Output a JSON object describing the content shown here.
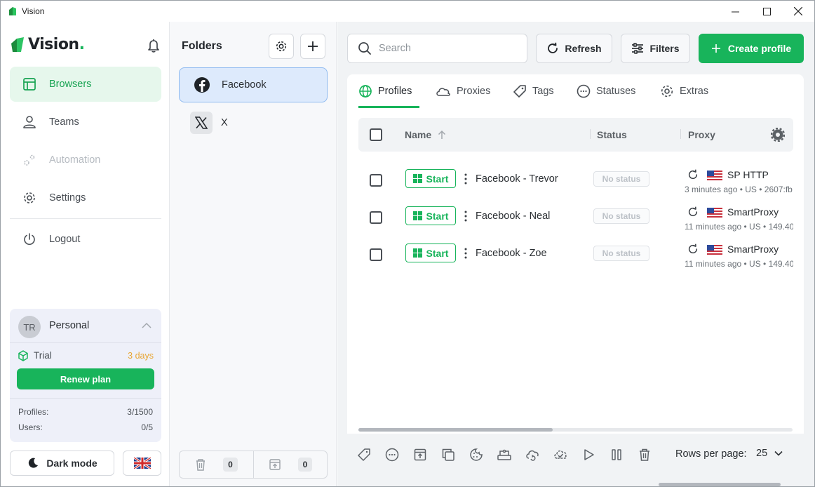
{
  "window": {
    "title": "Vision"
  },
  "sidebar": {
    "logo_text": "Vision",
    "logo_dot": ".",
    "nav": [
      {
        "label": "Browsers",
        "icon": "browser-window-icon",
        "state": "active"
      },
      {
        "label": "Teams",
        "icon": "user-icon",
        "state": "normal"
      },
      {
        "label": "Automation",
        "icon": "gears-icon",
        "state": "disabled"
      },
      {
        "label": "Settings",
        "icon": "gear-icon",
        "state": "normal"
      },
      {
        "label": "Logout",
        "icon": "power-icon",
        "state": "normal"
      }
    ],
    "account": {
      "initials": "TR",
      "name": "Personal",
      "plan_label": "Trial",
      "plan_remaining": "3 days",
      "renew_label": "Renew plan",
      "profiles_label": "Profiles:",
      "profiles_value": "3/1500",
      "users_label": "Users:",
      "users_value": "0/5"
    },
    "dark_mode_label": "Dark mode",
    "language": "en-GB"
  },
  "folders": {
    "title": "Folders",
    "items": [
      {
        "label": "Facebook",
        "icon": "facebook-icon",
        "active": true
      },
      {
        "label": "X",
        "icon": "x-logo-icon",
        "active": false
      }
    ],
    "trash_count": "0",
    "archive_count": "0"
  },
  "toolbar": {
    "search_placeholder": "Search",
    "refresh_label": "Refresh",
    "filters_label": "Filters",
    "create_label": "Create profile"
  },
  "tabs": [
    {
      "label": "Profiles",
      "icon": "globe-icon"
    },
    {
      "label": "Proxies",
      "icon": "cloud-icon"
    },
    {
      "label": "Tags",
      "icon": "tag-icon"
    },
    {
      "label": "Statuses",
      "icon": "dots-circle-icon"
    },
    {
      "label": "Extras",
      "icon": "gear-icon"
    }
  ],
  "table": {
    "columns": {
      "name": "Name",
      "status": "Status",
      "proxy": "Proxy"
    },
    "start_label": "Start",
    "rows": [
      {
        "name": "Facebook - Trevor",
        "status": "No status",
        "proxy_name": "SP HTTP",
        "proxy_meta": "3 minutes ago • US • 2607:fb"
      },
      {
        "name": "Facebook - Neal",
        "status": "No status",
        "proxy_name": "SmartProxy",
        "proxy_meta": "11 minutes ago • US • 149.40"
      },
      {
        "name": "Facebook - Zoe",
        "status": "No status",
        "proxy_name": "SmartProxy",
        "proxy_meta": "11 minutes ago • US • 149.40"
      }
    ]
  },
  "footer": {
    "rows_per_page_label": "Rows per page:",
    "rows_per_page_value": "25"
  },
  "colors": {
    "accent": "#18b45b",
    "active_nav_bg": "#e6f7ec",
    "trial": "#e8a634",
    "folder_active_bg": "#ddeafc"
  }
}
